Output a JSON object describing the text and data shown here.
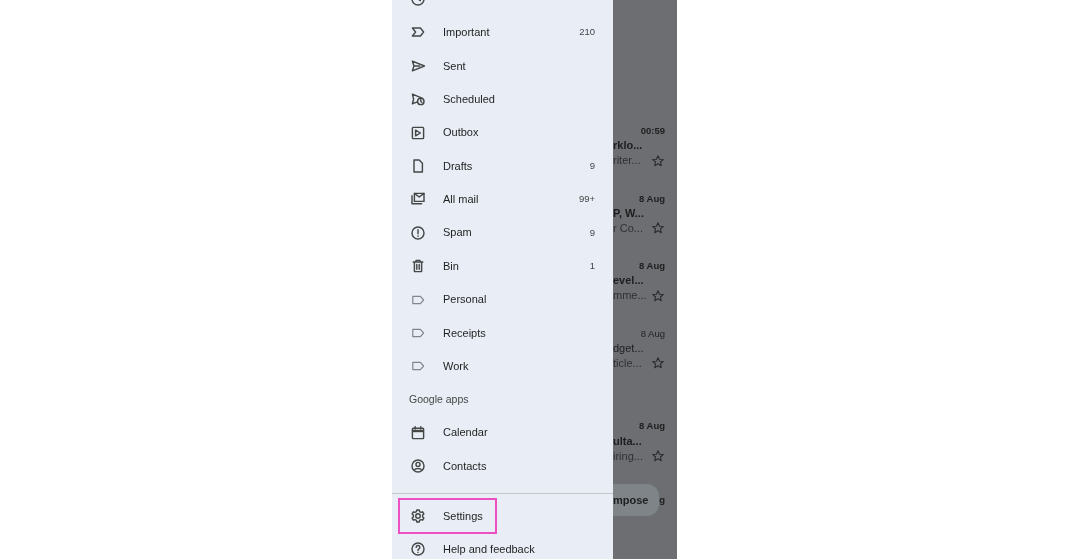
{
  "drawer": {
    "items": [
      {
        "kind": "snoozed",
        "highlighted": false
      },
      {
        "kind": "important",
        "label": "Important",
        "count": "210",
        "highlighted": false
      },
      {
        "kind": "sent",
        "label": "Sent",
        "highlighted": false
      },
      {
        "kind": "scheduled",
        "label": "Scheduled",
        "highlighted": false
      },
      {
        "kind": "outbox",
        "label": "Outbox",
        "highlighted": false
      },
      {
        "kind": "drafts",
        "label": "Drafts",
        "count": "9",
        "highlighted": false
      },
      {
        "kind": "allmail",
        "label": "All mail",
        "count": "99+",
        "highlighted": false
      },
      {
        "kind": "spam",
        "label": "Spam",
        "count": "9",
        "highlighted": false
      },
      {
        "kind": "bin",
        "label": "Bin",
        "count": "1",
        "highlighted": false
      },
      {
        "kind": "label",
        "label": "Personal",
        "highlighted": false
      },
      {
        "kind": "label",
        "label": "Receipts",
        "highlighted": false
      },
      {
        "kind": "label",
        "label": "Work",
        "highlighted": false
      },
      {
        "kind": "header",
        "label": "Google apps"
      },
      {
        "kind": "calendar",
        "label": "Calendar",
        "highlighted": false
      },
      {
        "kind": "contacts",
        "label": "Contacts",
        "highlighted": false
      },
      {
        "kind": "divider"
      },
      {
        "kind": "settings",
        "label": "Settings",
        "highlighted": true
      },
      {
        "kind": "help",
        "label": "Help and feedback",
        "highlighted": false
      }
    ]
  },
  "background_inbox": {
    "emails": [
      {
        "date": "00:59",
        "sender": "rklo...",
        "snippet": "riter...",
        "unread": true
      },
      {
        "date": "8 Aug",
        "sender": "P, W...",
        "snippet": "r Co...",
        "unread": true
      },
      {
        "date": "8 Aug",
        "sender": "evel...",
        "snippet": "mme...",
        "unread": true
      },
      {
        "date": "8 Aug",
        "sender": "dget...",
        "snippet": "ticle...",
        "unread": false
      },
      {
        "date": "8 Aug",
        "sender": "ulta...",
        "snippet": "iring...",
        "unread": true
      }
    ],
    "compose_button": "mpose",
    "partial_date": "g"
  }
}
